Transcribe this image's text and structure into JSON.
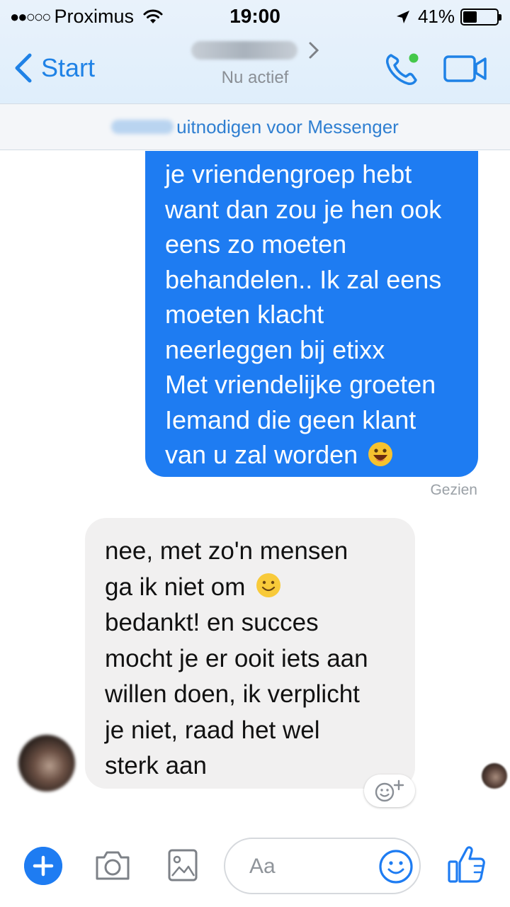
{
  "status_bar": {
    "signal": "●●○○○",
    "carrier": "Proximus",
    "time": "19:00",
    "battery_percent": "41%",
    "battery_level": 0.41
  },
  "nav": {
    "back_label": "Start",
    "contact_status": "Nu actief"
  },
  "invite_bar": {
    "text": "uitnodigen voor Messenger"
  },
  "messages": {
    "sent": {
      "lines": [
        "je vriendengroep hebt",
        "want dan zou je hen ook",
        "eens zo moeten",
        "behandelen.. Ik zal eens",
        "moeten klacht",
        "neerleggen bij etixx",
        "Met vriendelijke groeten",
        "Iemand die geen klant",
        "van u zal worden"
      ],
      "seen_label": "Gezien"
    },
    "received": {
      "lines": [
        "nee, met zo'n mensen",
        "ga ik niet om",
        "bedankt! en succes",
        "mocht je er ooit iets aan",
        "willen doen, ik verplicht",
        "je niet, raad het wel",
        "sterk aan"
      ]
    }
  },
  "composer": {
    "placeholder": "Aa"
  },
  "colors": {
    "accent": "#1e7cf2",
    "sent_bubble": "#1e7cf2",
    "received_bubble": "#f1f0f0",
    "online_dot": "#44c84a"
  }
}
